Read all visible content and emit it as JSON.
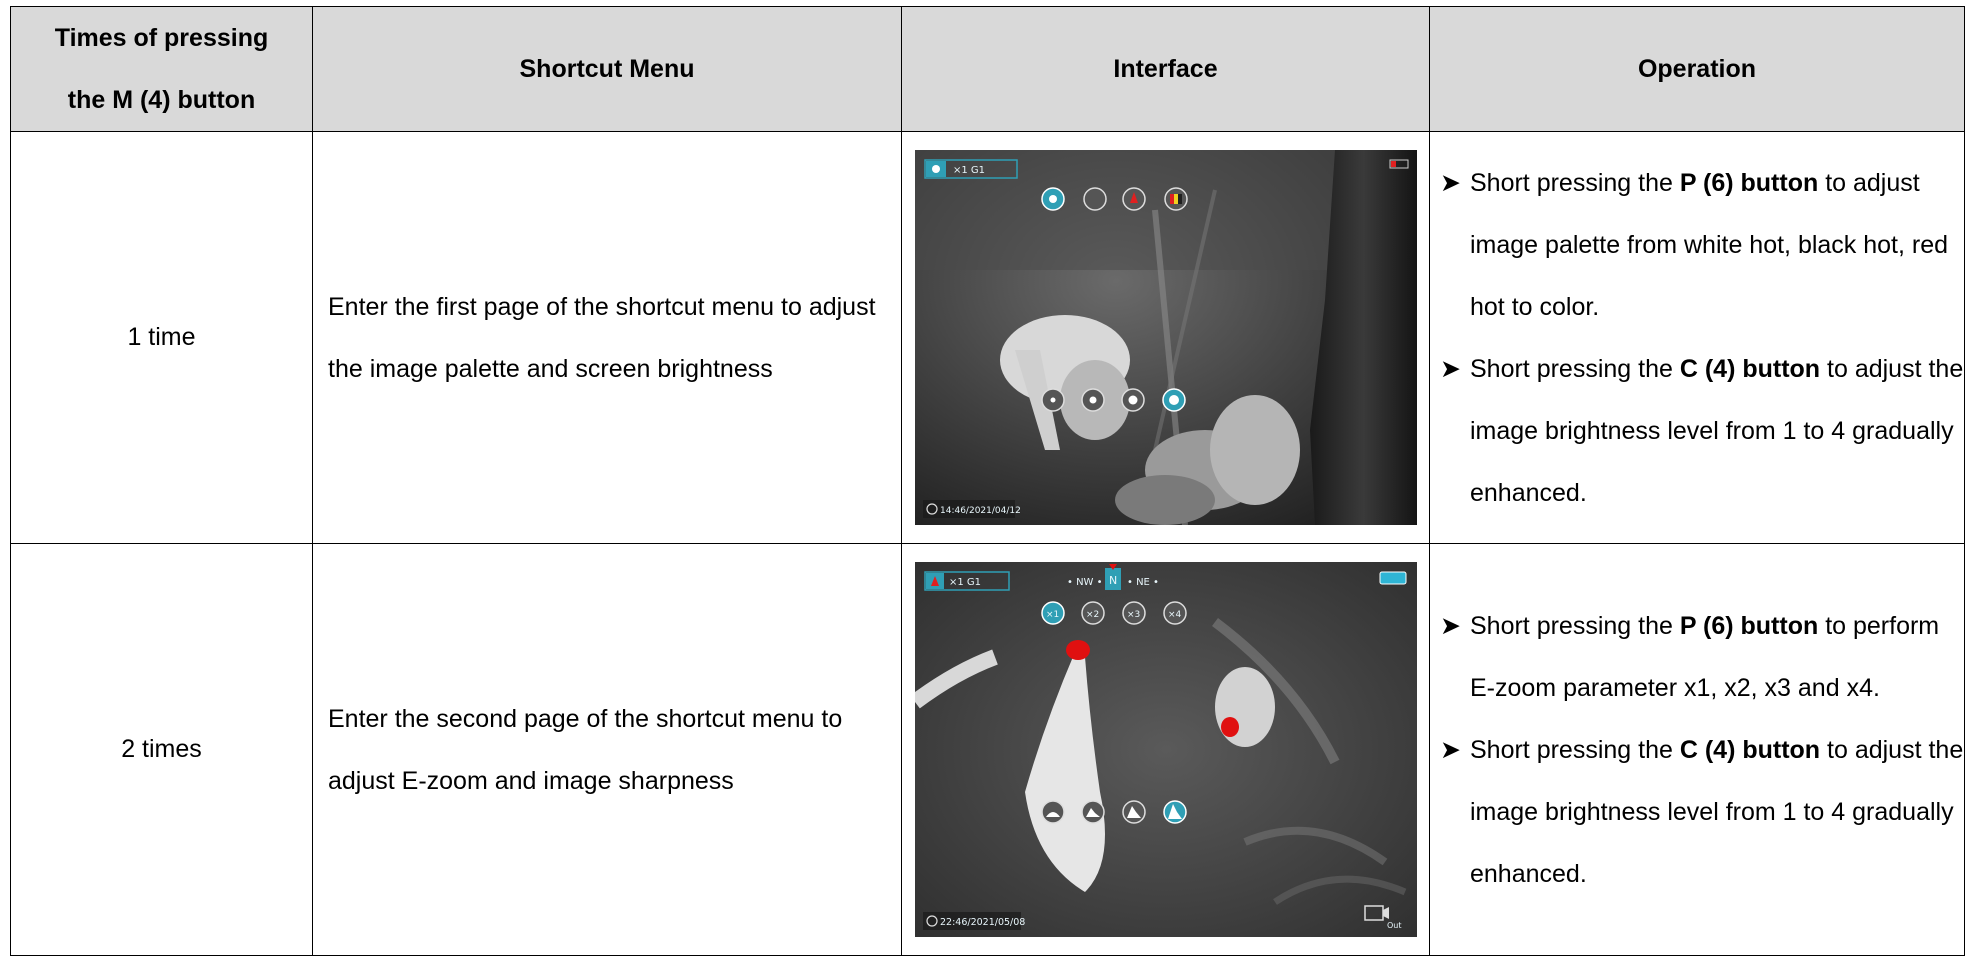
{
  "headers": {
    "col1_line1": "Times of pressing",
    "col1_line2": "the M (4) button",
    "col2": "Shortcut Menu",
    "col3": "Interface",
    "col4": "Operation"
  },
  "rows": [
    {
      "times": "1 time",
      "menu": "Enter the first page of the shortcut menu to adjust the image palette and screen brightness",
      "screen": {
        "status": "×1  G1",
        "timestamp": "14:46/2021/04/12"
      },
      "ops": [
        {
          "pre": "Short pressing the ",
          "bold": "P (6) button",
          "post": " to adjust image palette from white hot, black hot, red hot to color."
        },
        {
          "pre": "Short pressing the ",
          "bold": "C (4) button",
          "post": " to adjust the image brightness level from 1 to 4 gradually enhanced."
        }
      ]
    },
    {
      "times": "2 times",
      "menu": "Enter the second page of the shortcut menu to adjust E-zoom and image sharpness",
      "screen": {
        "status": "×1  G1",
        "compass_left": "• NW •",
        "compass_center": "N",
        "compass_right": "• NE •",
        "zoom": [
          "×1",
          "×2",
          "×3",
          "×4"
        ],
        "timestamp": "22:46/2021/05/08",
        "out_label": "Out"
      },
      "ops": [
        {
          "pre": "Short pressing the ",
          "bold": "P (6) button",
          "post": " to perform E-zoom parameter x1, x2, x3 and x4."
        },
        {
          "pre": "Short pressing the ",
          "bold": "C (4) button",
          "post": " to adjust the image brightness level from 1 to 4 gradually enhanced."
        }
      ]
    }
  ],
  "colors": {
    "header_bg": "#d9d9d9",
    "osd_accent": "#2f9fb5",
    "hot_red": "#e01010"
  }
}
